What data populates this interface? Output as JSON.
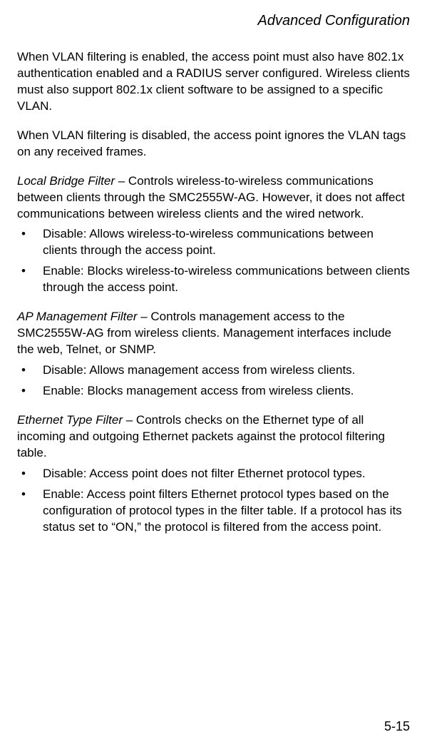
{
  "header": "Advanced Configuration",
  "para1": "When VLAN filtering is enabled, the access point must also have 802.1x authentication enabled and a RADIUS server configured. Wireless clients must also support 802.1x client software to be assigned to a specific VLAN.",
  "para2": "When VLAN filtering is disabled, the access point ignores the VLAN tags on any received frames.",
  "local_bridge": {
    "term": "Local Bridge Filter",
    "desc": " – Controls wireless-to-wireless communications between clients through the SMC2555W-AG. However, it does not affect communications between wireless clients and the wired network.",
    "bullets": [
      "Disable: Allows wireless-to-wireless communications between clients through the access point.",
      "Enable: Blocks wireless-to-wireless communications between clients through the access point."
    ]
  },
  "ap_mgmt": {
    "term": "AP Management Filter",
    "desc": " – Controls management access to the SMC2555W-AG from wireless clients. Management interfaces include the web, Telnet, or SNMP.",
    "bullets": [
      "Disable: Allows management access from wireless clients.",
      "Enable: Blocks management access from wireless clients."
    ]
  },
  "eth_type": {
    "term": "Ethernet Type Filter",
    "desc": " – Controls checks on the Ethernet type of all incoming and outgoing Ethernet packets against the protocol filtering table.",
    "bullets": [
      "Disable: Access point does not filter Ethernet protocol types.",
      "Enable: Access point filters Ethernet protocol types based on the configuration of protocol types in the filter table. If a protocol has its status set to “ON,” the protocol is filtered from the access point."
    ]
  },
  "page_number": "5-15"
}
